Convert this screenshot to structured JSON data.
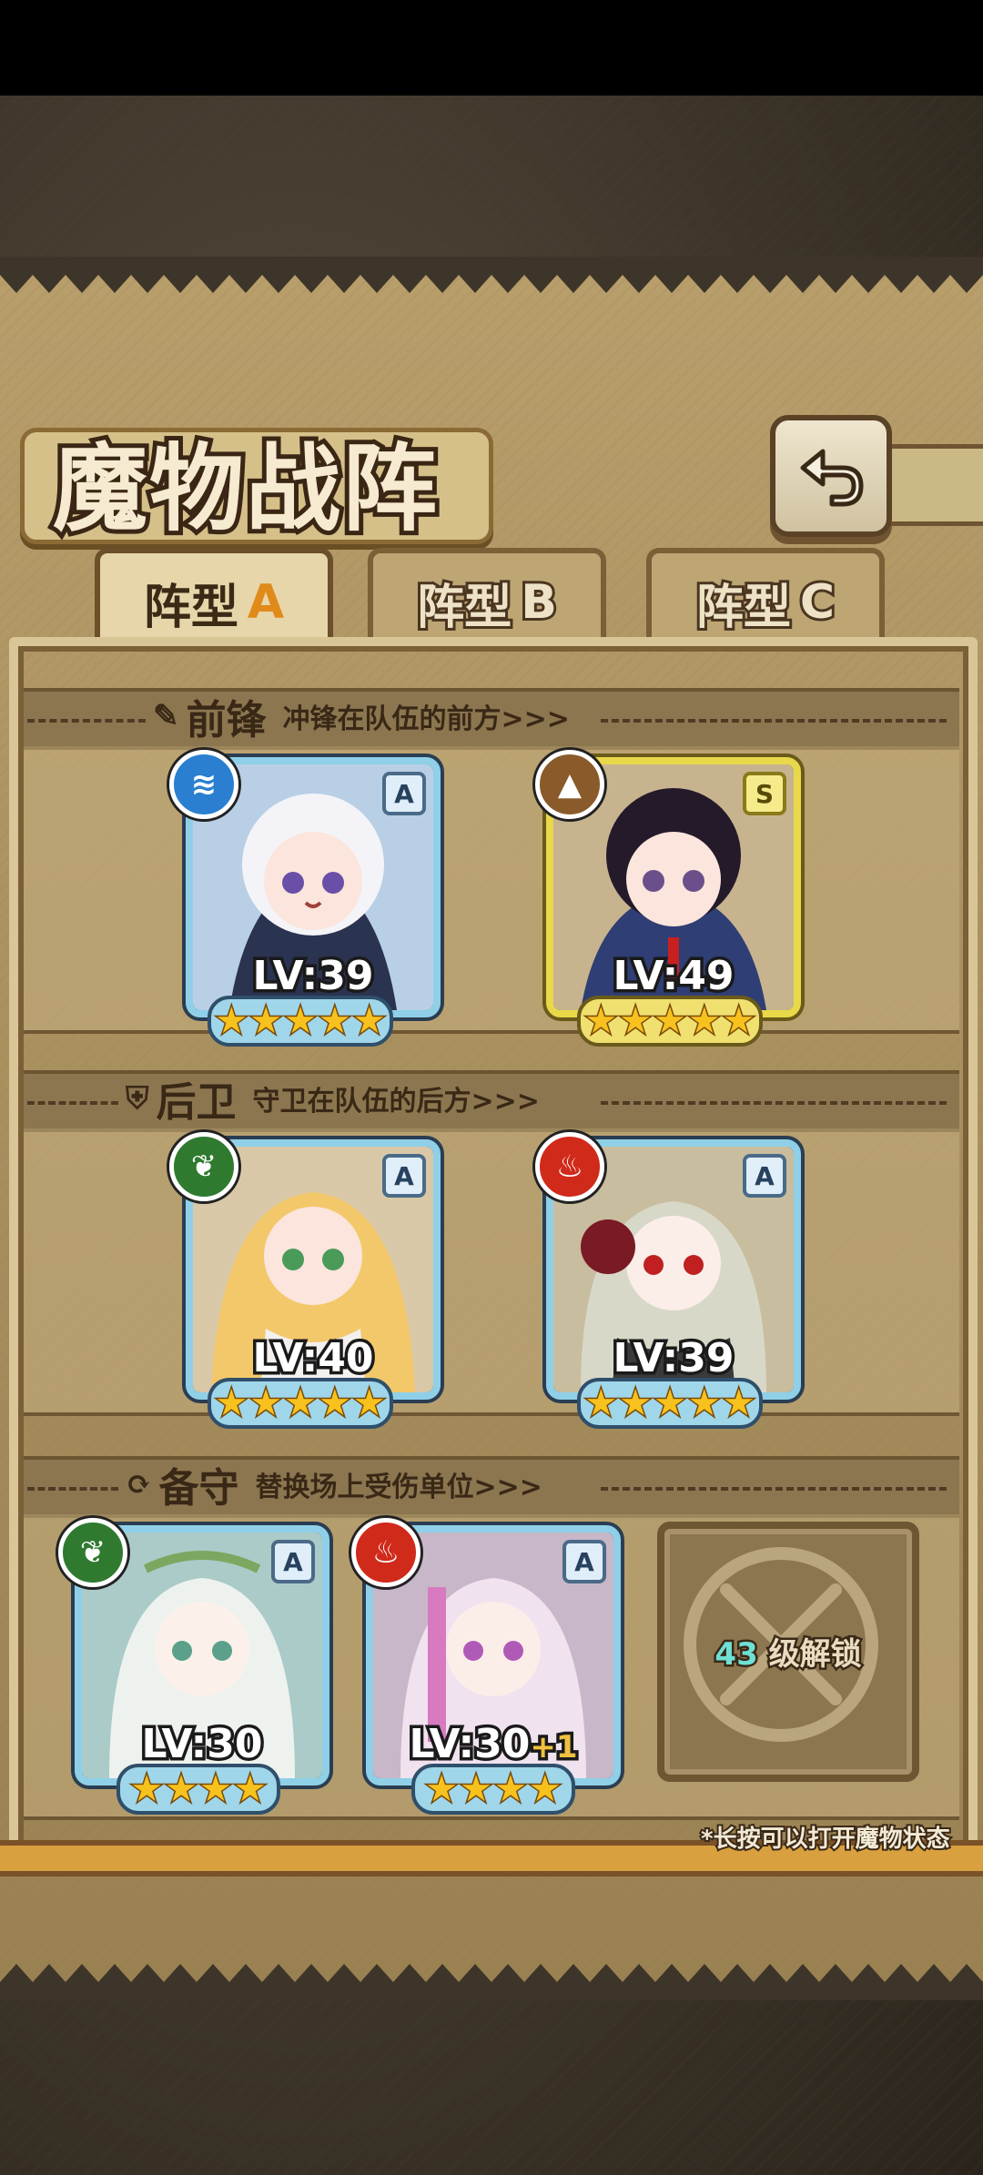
{
  "title": "魔物战阵",
  "tabs": [
    {
      "label": "阵型",
      "letter": "A",
      "active": true
    },
    {
      "label": "阵型",
      "letter": "B",
      "active": false
    },
    {
      "label": "阵型",
      "letter": "C",
      "active": false
    }
  ],
  "sections": {
    "front": {
      "title": "前锋",
      "subtitle": "冲锋在队伍的前方>>>"
    },
    "rear": {
      "title": "后卫",
      "subtitle": "守卫在队伍的后方>>>"
    },
    "reserve": {
      "title": "备守",
      "subtitle": "替换场上受伤单位>>>"
    }
  },
  "units": [
    {
      "lv": "LV:39",
      "rank": "A",
      "element": "water-icon",
      "stars": 5,
      "plus": ""
    },
    {
      "lv": "LV:49",
      "rank": "S",
      "element": "earth-icon",
      "stars": 5,
      "plus": ""
    },
    {
      "lv": "LV:40",
      "rank": "A",
      "element": "leaf-icon",
      "stars": 5,
      "plus": ""
    },
    {
      "lv": "LV:39",
      "rank": "A",
      "element": "fire-icon",
      "stars": 5,
      "plus": ""
    },
    {
      "lv": "LV:30",
      "rank": "A",
      "element": "leaf-icon",
      "stars": 4,
      "plus": ""
    },
    {
      "lv": "LV:30",
      "rank": "A",
      "element": "fire-icon",
      "stars": 4,
      "plus": "+1"
    }
  ],
  "locked_slot": {
    "level": "43",
    "label": "级解锁"
  },
  "hint": "*长按可以打开魔物状态",
  "colors": {
    "water": "#2a7fd0",
    "earth": "#8a5a2a",
    "leaf": "#2f7a2f",
    "fire": "#d02a1a"
  }
}
